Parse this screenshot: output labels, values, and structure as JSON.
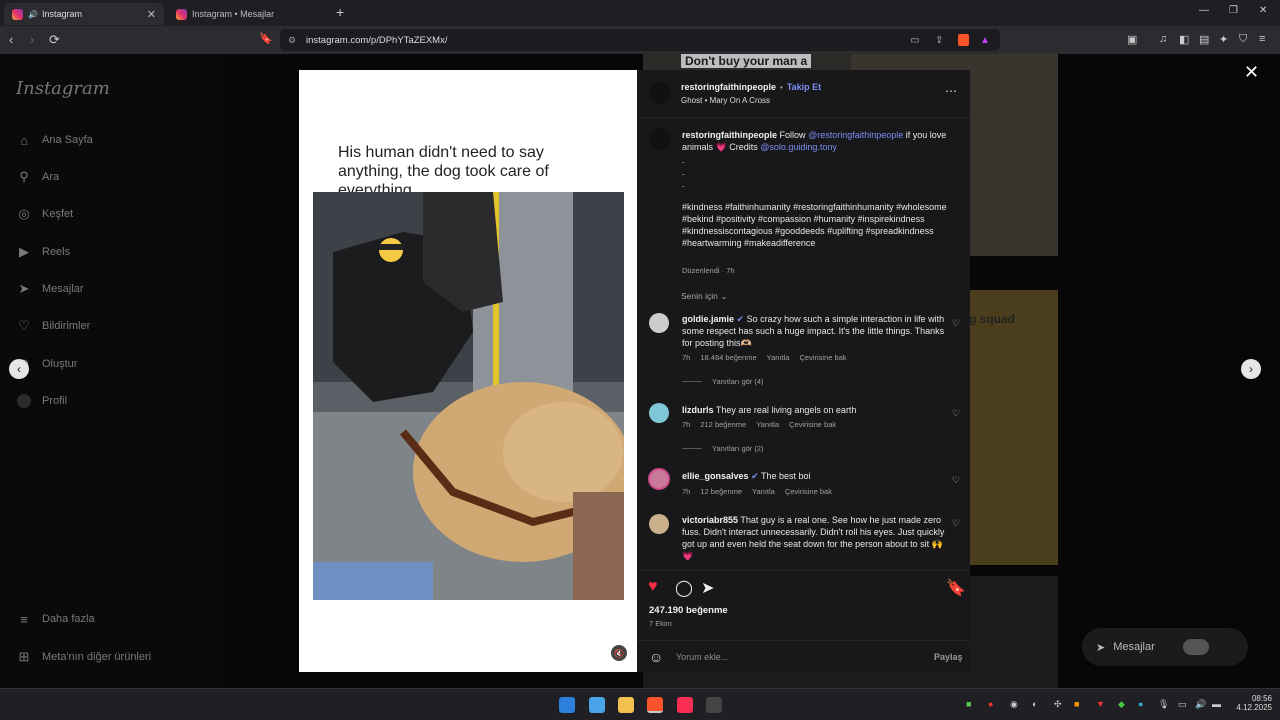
{
  "browser": {
    "tabs": [
      {
        "label": "Instagram"
      },
      {
        "label": "Instagram • Mesajlar"
      }
    ],
    "url": "instagram.com/p/DPhYTaZEXMx/"
  },
  "sidebar": {
    "logo": "Instagram",
    "items": [
      {
        "label": "Ana Sayfa",
        "icon": "home-icon"
      },
      {
        "label": "Ara",
        "icon": "search-icon"
      },
      {
        "label": "Keşfet",
        "icon": "compass-icon"
      },
      {
        "label": "Reels",
        "icon": "reels-icon"
      },
      {
        "label": "Mesajlar",
        "icon": "send-icon"
      },
      {
        "label": "Bildirimler",
        "icon": "heart-icon"
      },
      {
        "label": "Oluştur",
        "icon": "plus-icon"
      },
      {
        "label": "Profil",
        "icon": "avatar-icon"
      }
    ],
    "more": "Daha fazla",
    "meta": "Meta'nın diğer ürünleri"
  },
  "media": {
    "caption": "His human didn't need to say anything, the dog took care of everything."
  },
  "post": {
    "username": "restoringfaithinpeople",
    "follow": "Takip Et",
    "audio": "Ghost • Mary On A Cross",
    "caption_user": "restoringfaithinpeople",
    "caption_pre": "Follow",
    "caption_mention": "@restoringfaithinpeople",
    "caption_mid": "if you love animals 💗 Credits",
    "caption_credit": "@solo.guiding.tony",
    "dots": ".",
    "hashtags": "#kindness #faithinhumanity #restoringfaithinhumanity #wholesome #bekind #positivity #compassion #humanity #inspirekindness #kindnessiscontagious #gooddeeds #uplifting #spreadkindness #heartwarming #makeadifference",
    "edited": "Düzenlendi · 7h",
    "for_you": "Senin için",
    "likes": "247.190 beğenme",
    "date": "7 Ekim",
    "comment_placeholder": "Yorum ekle...",
    "share": "Paylaş"
  },
  "comments": [
    {
      "user": "goldie.jamie",
      "verified": true,
      "text": "So crazy how such a simple interaction in life with some respect has such a huge impact. It's the little things. Thanks for posting this🫶🏼",
      "time": "7h",
      "likes": "18.484 beğenme",
      "reply": "Yanıtla",
      "translate": "Çevirisine bak",
      "replies": "Yanıtları gör (4)"
    },
    {
      "user": "lizdurls",
      "verified": false,
      "text": "They are real living angels on earth",
      "time": "7h",
      "likes": "212 beğenme",
      "reply": "Yanıtla",
      "translate": "Çevirisine bak",
      "replies": "Yanıtları gör (2)"
    },
    {
      "user": "ellie_gonsalves",
      "verified": true,
      "text": "The best boi",
      "time": "7h",
      "likes": "12 beğenme",
      "reply": "Yanıtla",
      "translate": "Çevirisine bak"
    },
    {
      "user": "victoriabr855",
      "verified": false,
      "text": "That guy is a real one. See how he just made zero fuss. Didn't interact unnecessarily. Didn't roll his eyes. Just quickly got up and even held the seat down for the person about to sit 🙌💗"
    }
  ],
  "background": {
    "tile_top": "Don't buy your man a",
    "tile_mid": "g squad",
    "dm_label": "Mesajlar"
  },
  "clock": {
    "time": "08:56",
    "date": "4.12.2025"
  },
  "colors": {
    "like": "#ff3040",
    "link": "#7b8cf2"
  }
}
